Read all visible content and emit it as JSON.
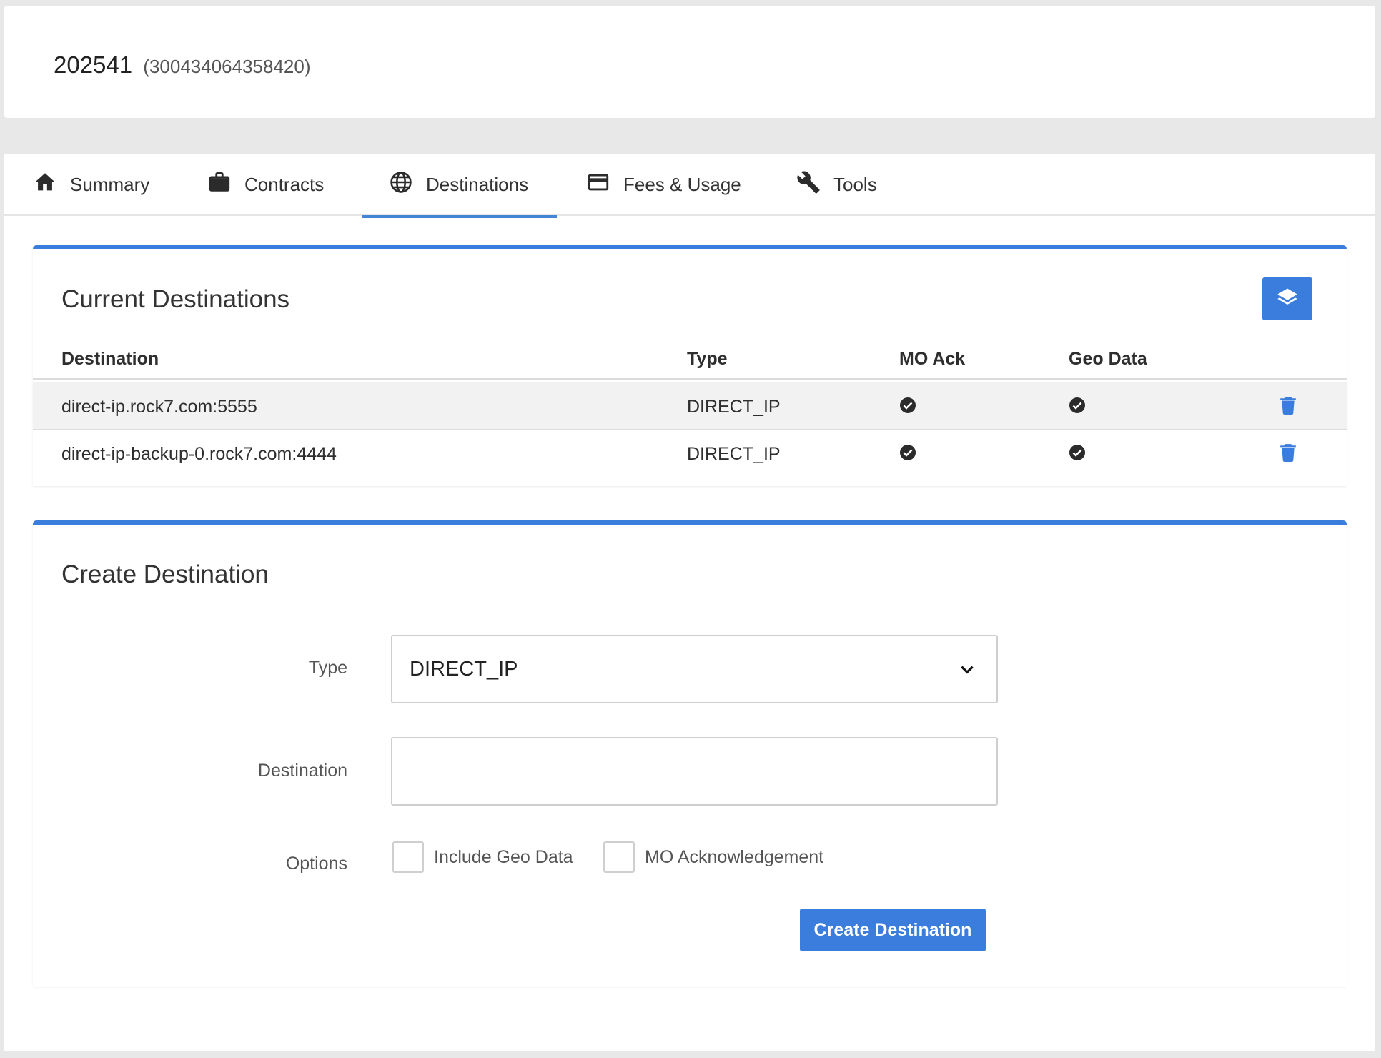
{
  "header": {
    "id": "202541",
    "imei": "(300434064358420)"
  },
  "tabs": [
    {
      "label": "Summary",
      "icon": "home-icon"
    },
    {
      "label": "Contracts",
      "icon": "briefcase-icon"
    },
    {
      "label": "Destinations",
      "icon": "globe-icon",
      "active": true
    },
    {
      "label": "Fees & Usage",
      "icon": "credit-card-icon"
    },
    {
      "label": "Tools",
      "icon": "wrench-icon"
    }
  ],
  "current": {
    "title": "Current Destinations",
    "columns": {
      "destination": "Destination",
      "type": "Type",
      "mo_ack": "MO Ack",
      "geo_data": "Geo Data"
    },
    "rows": [
      {
        "destination": "direct-ip.rock7.com:5555",
        "type": "DIRECT_IP",
        "mo_ack": true,
        "geo_data": true
      },
      {
        "destination": "direct-ip-backup-0.rock7.com:4444",
        "type": "DIRECT_IP",
        "mo_ack": true,
        "geo_data": true
      }
    ]
  },
  "create": {
    "title": "Create Destination",
    "type_label": "Type",
    "type_value": "DIRECT_IP",
    "destination_label": "Destination",
    "destination_value": "",
    "options_label": "Options",
    "option_geo": "Include Geo Data",
    "option_mo": "MO Acknowledgement",
    "submit_label": "Create Destination"
  },
  "colors": {
    "accent": "#3b7ddd",
    "background": "#e8e8e8"
  }
}
